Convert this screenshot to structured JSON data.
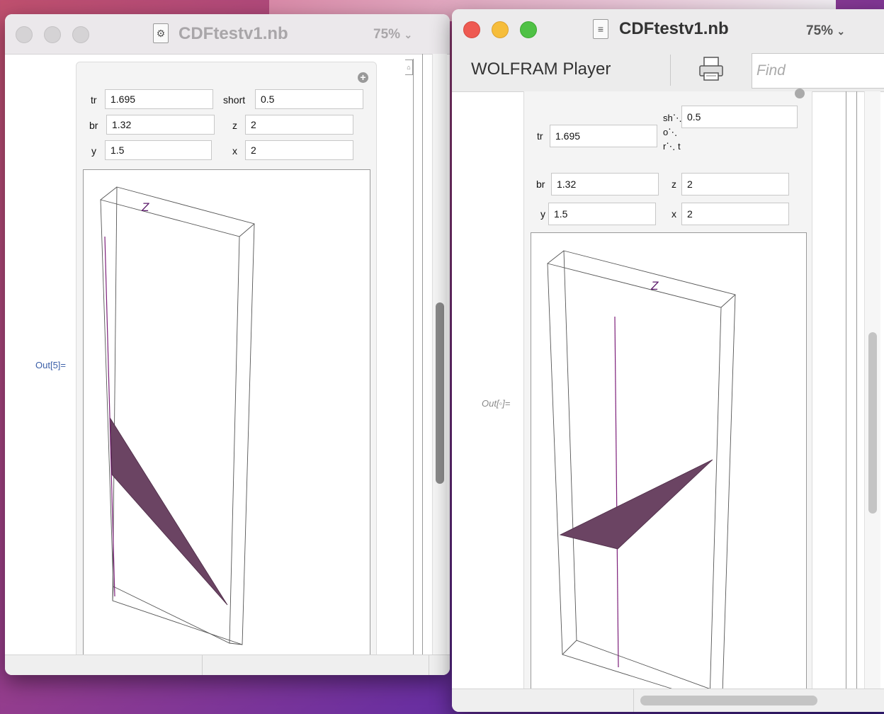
{
  "left_window": {
    "title": "CDFtestv1.nb",
    "zoom": "75%",
    "output_label": "Out[5]=",
    "controls": {
      "tr": {
        "label": "tr",
        "value": "1.695"
      },
      "short": {
        "label": "short",
        "value": "0.5"
      },
      "br": {
        "label": "br",
        "value": "1.32"
      },
      "z": {
        "label": "z",
        "value": "2"
      },
      "y": {
        "label": "y",
        "value": "1.5"
      },
      "x": {
        "label": "x",
        "value": "2"
      }
    },
    "plot_axis_label": "Z",
    "icons": [
      "gear-icon",
      "add-icon",
      "chevron-down-icon"
    ]
  },
  "right_window": {
    "title": "CDFtestv1.nb",
    "zoom": "75%",
    "toolbar": {
      "brand": "WOLFRAM Player",
      "find_placeholder": "Find"
    },
    "output_label": "Out[◦]=",
    "controls": {
      "tr": {
        "label": "tr",
        "value": "1.695"
      },
      "short": {
        "label": "sh⋱ o⋱ r⋱ t",
        "value": "0.5"
      },
      "br": {
        "label": "br",
        "value": "1.32"
      },
      "z": {
        "label": "z",
        "value": "2"
      },
      "y": {
        "label": "y",
        "value": "1.5"
      },
      "x": {
        "label": "x",
        "value": "2"
      }
    },
    "plot_axis_label": "Z",
    "icons": [
      "print-icon",
      "chevron-down-icon"
    ]
  },
  "colors": {
    "surface": "#6b4463",
    "axis_line": "#7d1f7a",
    "label_purple": "#5b1a6a",
    "output_label_left": "#3b5fa8",
    "output_label_right": "#888888"
  }
}
